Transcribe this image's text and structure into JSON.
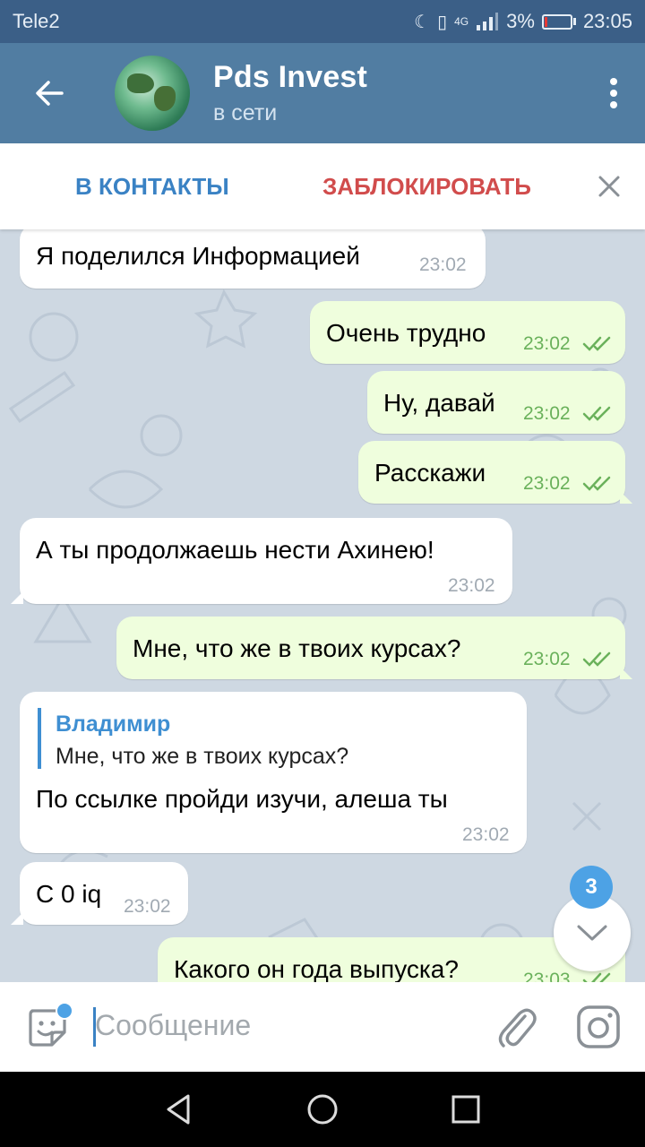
{
  "status_bar": {
    "carrier": "Tele2",
    "network": "4G",
    "battery": "3%",
    "time": "23:05"
  },
  "header": {
    "title": "Pds Invest",
    "subtitle": "в сети"
  },
  "action_bar": {
    "add_contact": "В КОНТАКТЫ",
    "block": "ЗАБЛОКИРОВАТЬ"
  },
  "messages": [
    {
      "direction": "in",
      "text": "Я поделился Информацией",
      "time": "23:02"
    },
    {
      "direction": "out",
      "text": "Очень трудно",
      "time": "23:02"
    },
    {
      "direction": "out",
      "text": "Ну, давай",
      "time": "23:02"
    },
    {
      "direction": "out",
      "text": "Расскажи",
      "time": "23:02"
    },
    {
      "direction": "in",
      "text": "А ты продолжаешь нести Ахинею!",
      "time": "23:02"
    },
    {
      "direction": "out",
      "text": "Мне, что же в твоих курсах?",
      "time": "23:02"
    },
    {
      "direction": "in",
      "reply_name": "Владимир",
      "reply_text": "Мне, что же в твоих курсах?",
      "text": "По ссылке пройди изучи, алеша ты",
      "time": "23:02"
    },
    {
      "direction": "in",
      "text": "С 0 iq",
      "time": "23:02"
    },
    {
      "direction": "out",
      "text": "Какого он года выпуска?",
      "time": "23:03"
    }
  ],
  "unread_count": "3",
  "input": {
    "placeholder": "Сообщение"
  },
  "colors": {
    "header": "#517da2",
    "status_bar": "#3b5f87",
    "chat_background": "#ced8e2",
    "outgoing_bubble": "#effedd",
    "accent": "#3a82c4",
    "danger": "#d14c4c"
  },
  "icons": [
    "back-arrow-icon",
    "more-vert-icon",
    "close-icon",
    "double-check-icon",
    "chevron-down-icon",
    "sticker-icon",
    "paperclip-icon",
    "camera-icon",
    "nav-back-icon",
    "nav-home-icon",
    "nav-recents-icon"
  ]
}
